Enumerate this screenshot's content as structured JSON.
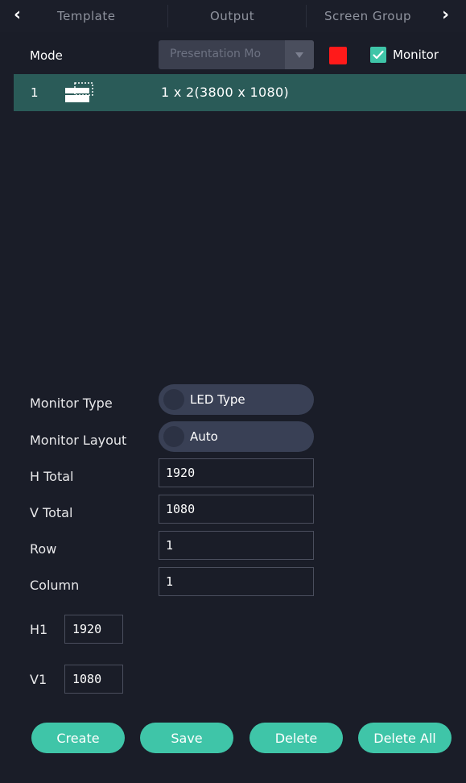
{
  "tabs": {
    "items": [
      "Template",
      "Output",
      "Screen Group"
    ]
  },
  "mode": {
    "label": "Mode",
    "select_value": "Presentation Mo",
    "swatch_color": "#ff1a1a",
    "monitor_checked": true,
    "monitor_label": "Monitor"
  },
  "list": {
    "rows": [
      {
        "index": "1",
        "icon": "layout-icon",
        "text": "1 x 2(3800 x 1080)"
      }
    ]
  },
  "form": {
    "monitor_type_label": "Monitor Type",
    "monitor_type_value": "LED Type",
    "monitor_layout_label": "Monitor Layout",
    "monitor_layout_value": "Auto",
    "h_total_label": "H Total",
    "h_total_value": "1920",
    "v_total_label": "V Total",
    "v_total_value": "1080",
    "row_label": "Row",
    "row_value": "1",
    "column_label": "Column",
    "column_value": "1",
    "h1_label": "H1",
    "h1_value": "1920",
    "v1_label": "V1",
    "v1_value": "1080"
  },
  "actions": {
    "create": "Create",
    "save": "Save",
    "delete": "Delete",
    "delete_all": "Delete All"
  },
  "colors": {
    "accent": "#3fc5a8",
    "selected_row": "#2a5b58",
    "background": "#1a1d28"
  }
}
